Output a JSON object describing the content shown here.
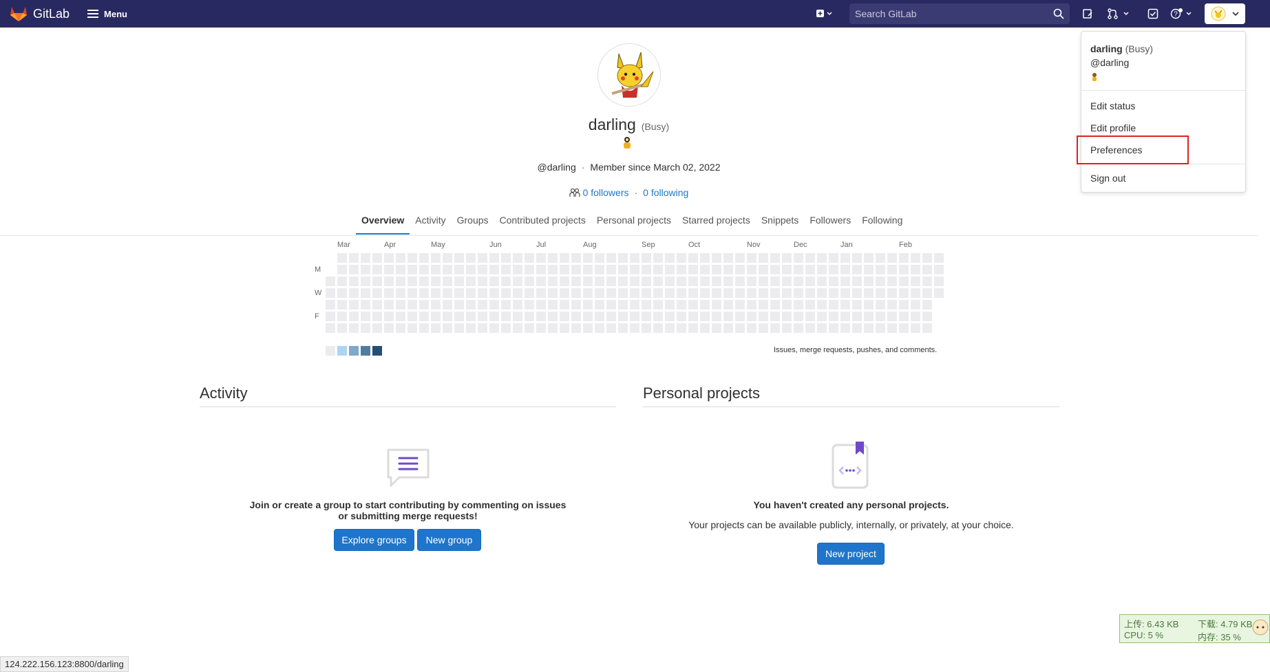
{
  "nav": {
    "brand": "GitLab",
    "menu_label": "Menu",
    "search_placeholder": "Search GitLab"
  },
  "dropdown": {
    "name": "darling",
    "status": "(Busy)",
    "username": "@darling",
    "items": [
      "Edit status",
      "Edit profile",
      "Preferences",
      "Sign out"
    ]
  },
  "profile": {
    "name": "darling",
    "status": "(Busy)",
    "username": "@darling",
    "member_since": "Member since March 02, 2022",
    "followers": "0 followers",
    "following": "0 following"
  },
  "tabs": [
    "Overview",
    "Activity",
    "Groups",
    "Contributed projects",
    "Personal projects",
    "Starred projects",
    "Snippets",
    "Followers",
    "Following"
  ],
  "calendar": {
    "months": [
      "Mar",
      "Apr",
      "May",
      "Jun",
      "Jul",
      "Aug",
      "Sep",
      "Oct",
      "Nov",
      "Dec",
      "Jan",
      "Feb"
    ],
    "days": [
      "M",
      "W",
      "F"
    ],
    "legend_text": "Issues, merge requests, pushes, and comments.",
    "legend_colors": [
      "#ececef",
      "#acd5f2",
      "#7fa8c9",
      "#527ba0",
      "#254e77"
    ],
    "cell_color": "#ececef"
  },
  "activity": {
    "title": "Activity",
    "empty_text": "Join or create a group to start contributing by commenting on issues or submitting merge requests!",
    "explore_button": "Explore groups",
    "new_group_button": "New group"
  },
  "personal_projects": {
    "title": "Personal projects",
    "empty_title": "You haven't created any personal projects.",
    "empty_text": "Your projects can be available publicly, internally, or privately, at your choice.",
    "new_project_button": "New project"
  },
  "status_bar": {
    "url": "124.222.156.123:8800/darling"
  },
  "net_monitor": {
    "upload": "上传: 6.43 KB",
    "download": "下载: 4.79 KB",
    "cpu": "CPU: 5 %",
    "memory": "内存: 35 %"
  }
}
